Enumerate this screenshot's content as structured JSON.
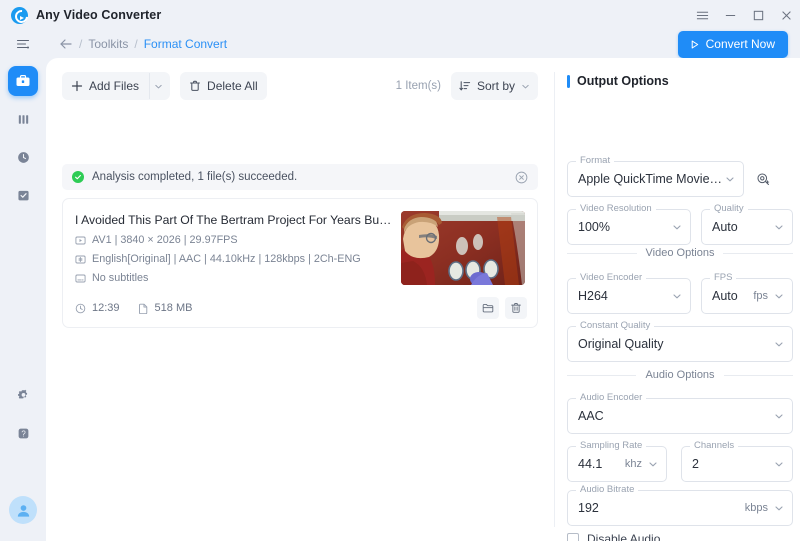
{
  "window": {
    "app_title": "Any Video Converter",
    "controls": [
      {
        "name": "menu",
        "icon": "hamburger-icon"
      },
      {
        "name": "minimize",
        "icon": "minimize-icon"
      },
      {
        "name": "maximize",
        "icon": "maximize-icon"
      },
      {
        "name": "close",
        "icon": "close-icon"
      }
    ]
  },
  "breadcrumb": {
    "menu_icon": "sidebar-toggle-icon",
    "back_icon": "back-arrow-icon",
    "sep": "/",
    "root": "Toolkits",
    "current": "Format Convert",
    "convert_button": "Convert Now",
    "convert_icon": "play-icon",
    "accent": "#1f8cf7"
  },
  "sidebar": {
    "items": [
      {
        "name": "toolkits",
        "icon": "toolbox-icon",
        "active": true
      },
      {
        "name": "library",
        "icon": "columns-icon",
        "active": false
      },
      {
        "name": "history",
        "icon": "clock-icon",
        "active": false
      },
      {
        "name": "tasks",
        "icon": "checked-box-icon",
        "active": false
      }
    ],
    "bottom": [
      {
        "name": "settings",
        "icon": "gear-icon"
      },
      {
        "name": "help",
        "icon": "question-icon"
      }
    ],
    "avatar_icon": "user-avatar-icon"
  },
  "toolbar": {
    "add_files": "Add Files",
    "add_files_icon": "plus-icon",
    "add_files_caret": "chevron-down-icon",
    "delete_all": "Delete All",
    "delete_all_icon": "trash-icon",
    "item_count": "1 Item(s)",
    "sort_by": "Sort by",
    "sort_icon": "sort-icon",
    "sort_caret": "chevron-down-icon"
  },
  "status": {
    "icon": "success-check-icon",
    "message": "Analysis completed, 1 file(s) succeeded.",
    "close_icon": "close-circle-icon",
    "color": "#2ecc55"
  },
  "file": {
    "title": "I Avoided This Part Of The Bertram Project For Years But It's Finally…",
    "video_icon": "video-track-icon",
    "video_info": "AV1 | 3840 × 2026 | 29.97FPS",
    "audio_icon": "audio-track-icon",
    "audio_info": "English[Original] | AAC | 44.10kHz | 128kbps | 2Ch-ENG",
    "subtitle_icon": "subtitle-icon",
    "subtitle_info": "No subtitles",
    "duration_icon": "clock-icon",
    "duration": "12:39",
    "size_icon": "file-icon",
    "size": "518 MB",
    "open_folder_icon": "folder-icon",
    "delete_icon": "trash-icon"
  },
  "output": {
    "title": "Output Options",
    "format": {
      "label": "Format",
      "value": "Apple QuickTime Movie(\"…"
    },
    "preview_icon": "zoom-plus-icon",
    "video_resolution": {
      "label": "Video Resolution",
      "value": "100%"
    },
    "quality": {
      "label": "Quality",
      "value": "Auto"
    },
    "video_section": "Video Options",
    "video_encoder": {
      "label": "Video Encoder",
      "value": "H264"
    },
    "fps": {
      "label": "FPS",
      "value": "Auto",
      "unit": "fps"
    },
    "constant_quality": {
      "label": "Constant Quality",
      "value": "Original Quality"
    },
    "audio_section": "Audio Options",
    "audio_encoder": {
      "label": "Audio Encoder",
      "value": "AAC"
    },
    "sampling_rate": {
      "label": "Sampling Rate",
      "value": "44.1",
      "unit": "khz"
    },
    "channels": {
      "label": "Channels",
      "value": "2"
    },
    "audio_bitrate": {
      "label": "Audio Bitrate",
      "value": "192",
      "unit": "kbps"
    },
    "disable_audio": "Disable Audio"
  }
}
